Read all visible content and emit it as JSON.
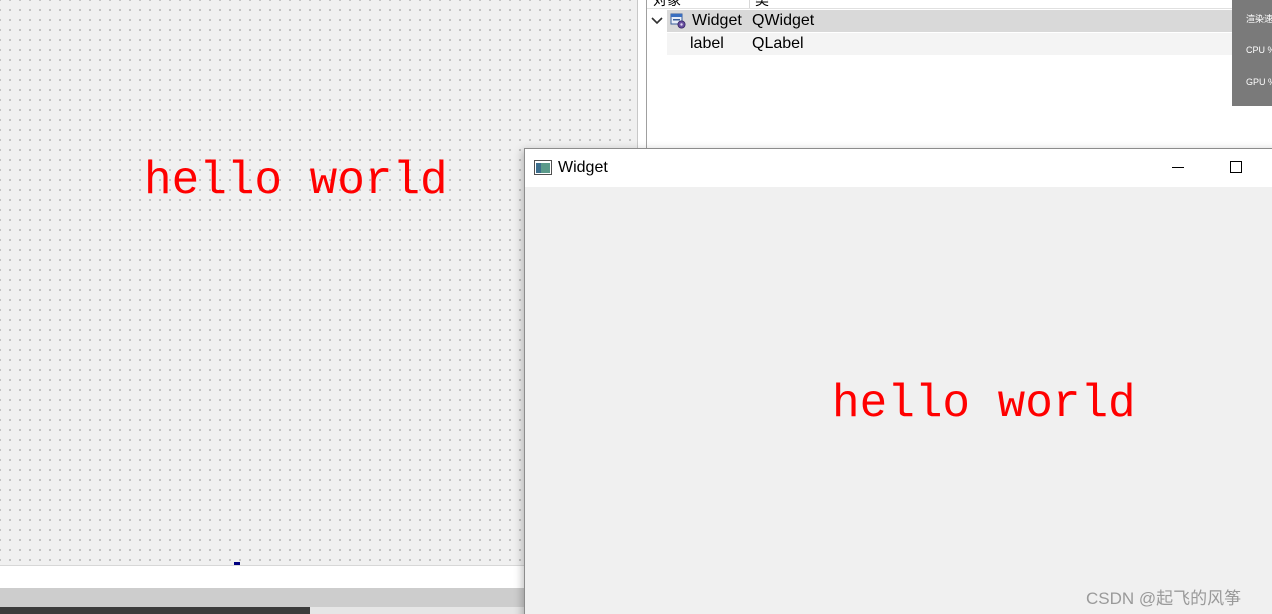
{
  "designer": {
    "label_text": "hello world"
  },
  "inspector": {
    "header_object": "对象",
    "header_class": "类",
    "rows": [
      {
        "name": "Widget",
        "class": "QWidget"
      },
      {
        "name": "label",
        "class": "QLabel"
      }
    ]
  },
  "performance_overlay": {
    "render_label": "渲染速",
    "cpu_label": "CPU %",
    "gpu_label": "GPU %"
  },
  "app_window": {
    "title": "Widget",
    "label_text": "hello world"
  },
  "watermark": "CSDN @起飞的风筝",
  "colors": {
    "label_text": "#ff0000",
    "selected_row": "#d9d9d9",
    "canvas_bg": "#f0f0f0"
  },
  "icons": {
    "expander": "chevron-down-icon",
    "widget_object": "qwidget-icon",
    "window": "window-icon"
  }
}
